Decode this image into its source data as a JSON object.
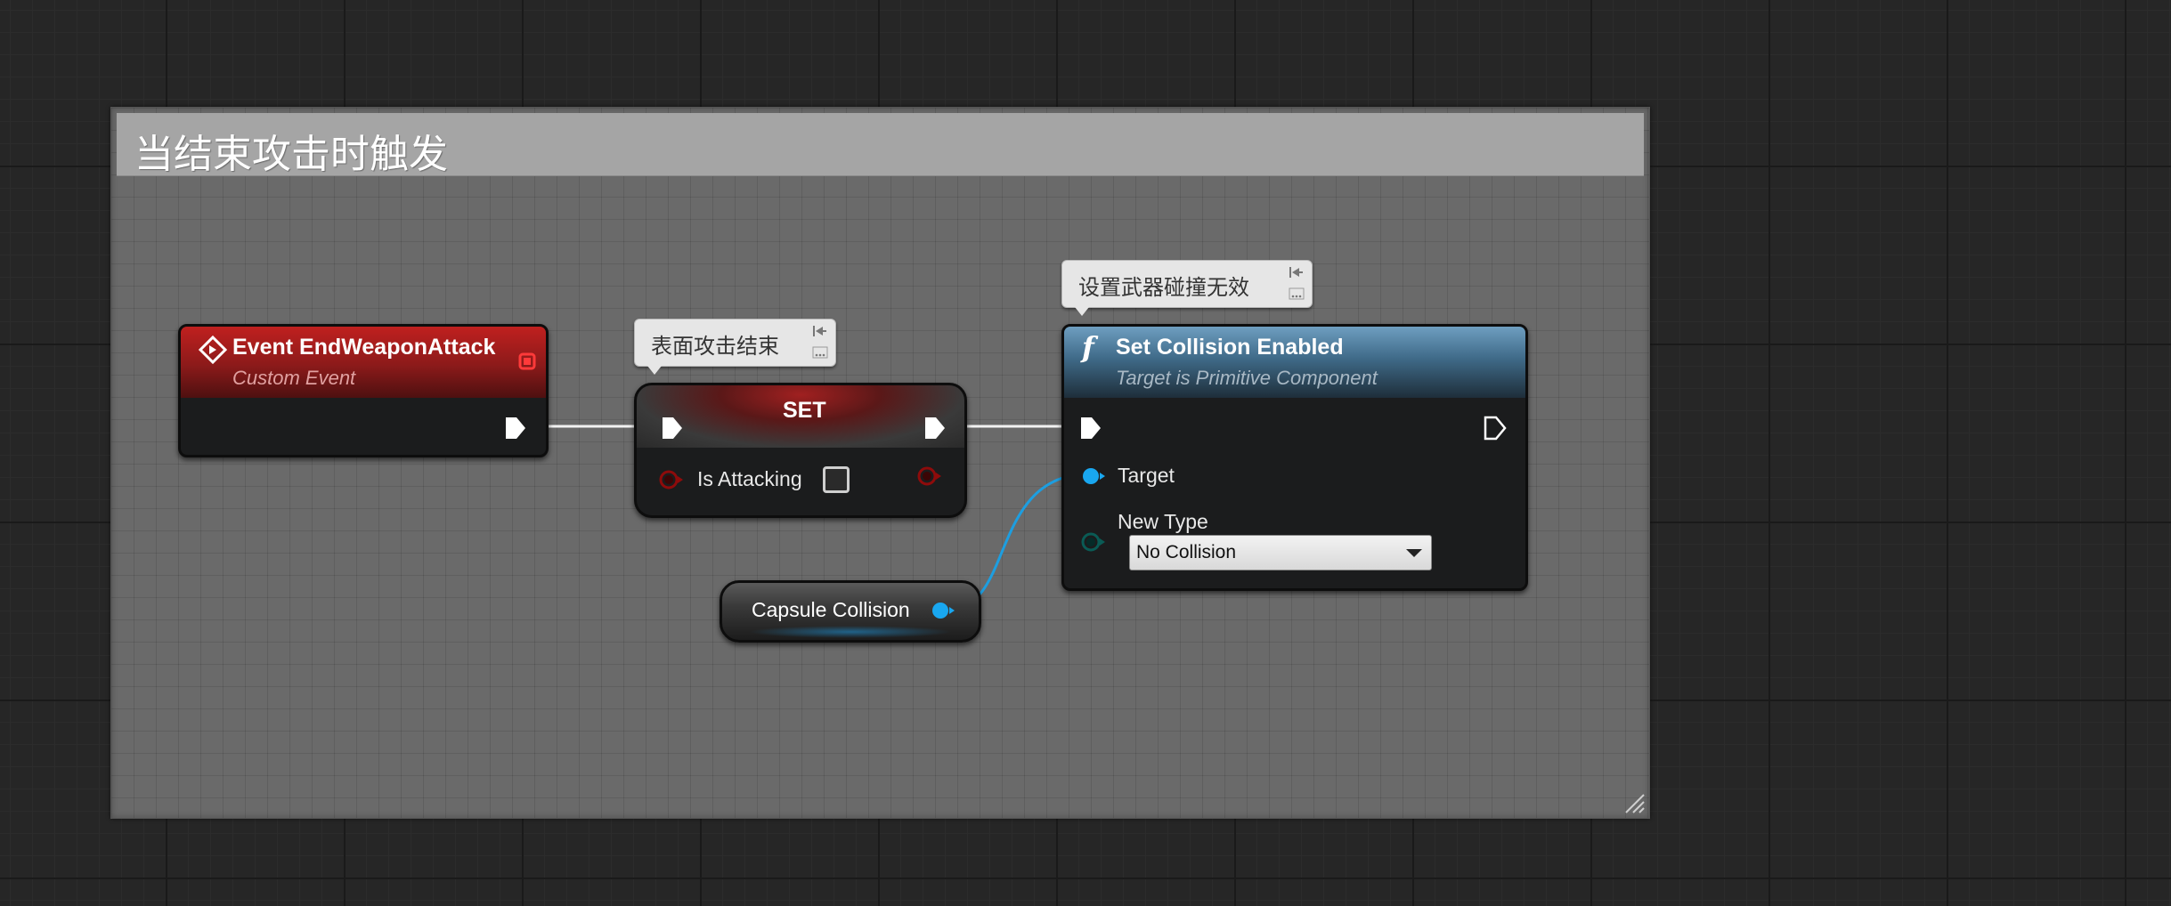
{
  "comment": {
    "title": "当结束攻击时触发"
  },
  "event_node": {
    "title": "Event EndWeaponAttack",
    "subtitle": "Custom Event"
  },
  "set_node": {
    "title": "SET",
    "pin_label": "Is Attacking",
    "bubble": "表面攻击结束",
    "is_attacking_checked": false
  },
  "collision_node": {
    "title": "Set Collision Enabled",
    "subtitle": "Target is Primitive Component",
    "bubble": "设置武器碰撞无效",
    "target_label": "Target",
    "new_type_label": "New Type",
    "new_type_value": "No Collision"
  },
  "capsule_node": {
    "label": "Capsule Collision"
  },
  "colors": {
    "event_header": "#8b1a1a",
    "function_header": "#3f6a88",
    "bool_pin": "#8e0b0b",
    "object_pin": "#19a7f0",
    "enum_pin": "#0a5b55",
    "exec_pin": "#ffffff"
  }
}
